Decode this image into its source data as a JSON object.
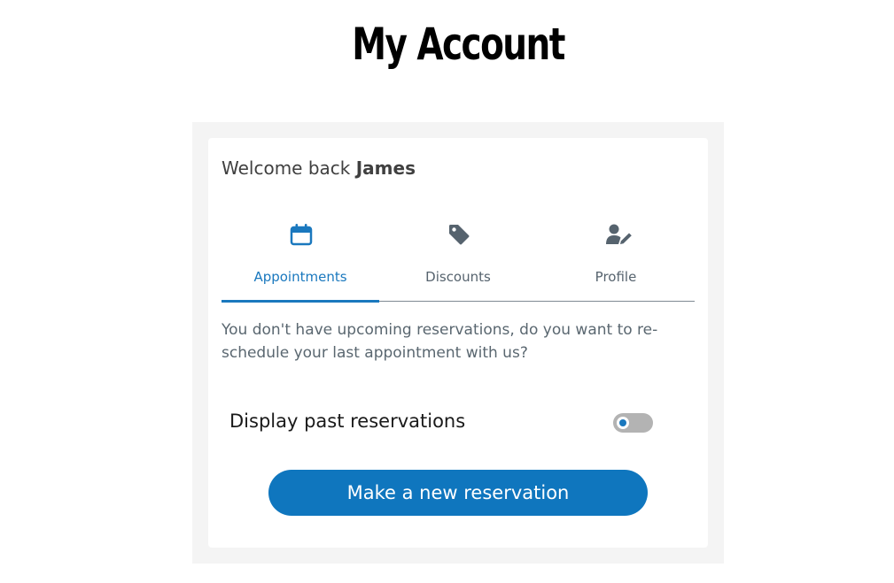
{
  "header": {
    "title": "My Account"
  },
  "welcome": {
    "prefix": "Welcome back ",
    "name": "James"
  },
  "tabs": [
    {
      "label": "Appointments",
      "icon": "calendar-icon",
      "active": true
    },
    {
      "label": "Discounts",
      "icon": "tag-icon",
      "active": false
    },
    {
      "label": "Profile",
      "icon": "user-edit-icon",
      "active": false
    }
  ],
  "message": "You don't have upcoming reservations, do you want to re-schedule your last appointment with us?",
  "toggle": {
    "label": "Display past reservations",
    "checked": false
  },
  "button": {
    "label": "Make a new reservation"
  },
  "colors": {
    "accent": "#1a78be",
    "muted_text": "#5a6770",
    "panel_background": "#f4f4f4"
  }
}
